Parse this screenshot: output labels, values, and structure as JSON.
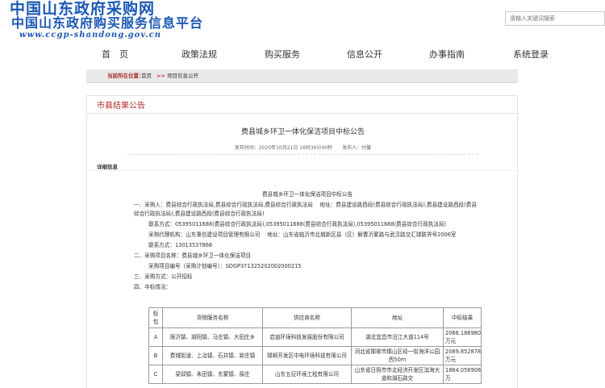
{
  "header": {
    "title_main": "中国山东政府采购网",
    "title_sub": "中国山东政府购买服务信息平台",
    "url": "www.ccgp-shandong.gov.cn",
    "search_placeholder": "请输入关键词搜索"
  },
  "nav": {
    "items": [
      "首　页",
      "政策法规",
      "购买服务",
      "信息公开",
      "办事指南",
      "系统登录"
    ]
  },
  "breadcrumb": {
    "label": "当前所在位置：",
    "home": "首页",
    "sep": ">>",
    "current": "项目信息公开"
  },
  "section": {
    "title": "市县结果公告",
    "detail_label": "详细信息"
  },
  "notice": {
    "title": "费县城乡环卫一体化保洁项目中标公告",
    "meta": "发布时间：2020年10月21日 16时36分40秒　　发布人：付馨  ",
    "lines": {
      "heading": "费县城乡环卫一体化保洁项目中标公告",
      "l1": "一、采购人：费县综合行政执法局,费县综合行政执法局,费县综合行政执法局　 地址：费县建设路西段(费县综合行政执法局),费县建设路西段(费县综合行政执法局),费县建设路西段(费县综合行政执法局)",
      "l2": "联系方式：05395011688(费县综合行政执法局),05395011688(费县综合行政执法局),05395011688(费县综合行政执法局)",
      "l3": "采购代理机构：山东秉信建设项目管理有限公司　 地址：山东省临沂市北城新区县（区）解曹沂蒙路与武汉路交汇球联界号2006室",
      "l4": "联系方式：13013537866",
      "l5": "二、采购项目名称：费县城乡环卫一体化保洁项目",
      "l6": "采购项目编号（采购计划编号）：SDGP371325202002000215",
      "l7": "三、采购方式：公开招标",
      "l8": "四、中标情况："
    }
  },
  "table": {
    "headers": [
      "标包",
      "货物服务名称",
      "供应商名称",
      "地址",
      "中标结果"
    ],
    "rows": [
      [
        "A",
        "探沂镇、胡阳镇、马庄镇、大田庄乡",
        "启迪环境科技发展股份有限公司",
        "湖北宜昌市沿江大道114号",
        "2066.186980万元"
      ],
      [
        "B",
        "费城街道、上冶镇、石井镇、新庄镇",
        "邯郸开发区中电环境科技有限公司",
        "河北省邯郸市邯山区经一街海洋公园西50m",
        "2089.852878万元"
      ],
      [
        "C",
        "梁邱镇、朱田镇、东蒙镇、薛庄",
        "山东五征环境工程有限公司",
        "山东省日照市市北经济开发区滨海大道和湖石路交",
        "1864.056908万"
      ]
    ]
  }
}
